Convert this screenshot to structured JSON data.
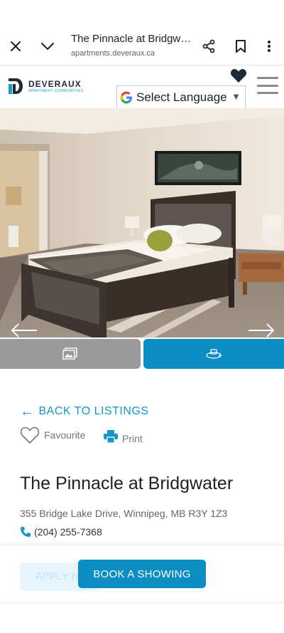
{
  "browser": {
    "title": "The Pinnacle at Bridgwat...",
    "url": "apartments.deveraux.ca"
  },
  "header": {
    "logo_name": "DEVERAUX",
    "logo_sub": "APARTMENT COMMUNITIES",
    "language_select": "Select Language"
  },
  "listing": {
    "back_label": "BACK TO LISTINGS",
    "favourite_label": "Favourite",
    "print_label": "Print",
    "title": "The Pinnacle at Bridgwater",
    "address": "355 Bridge Lake Drive, Winnipeg, MB R3Y 1Z3",
    "phone": "(204) 255-7368"
  },
  "cta": {
    "apply_label": "APPLY N",
    "book_label": "BOOK A SHOWING"
  },
  "colors": {
    "brand_blue": "#0b8fc2",
    "link_blue": "#1596c9",
    "toggle_gray": "#9a9a9a"
  },
  "icons": [
    "close-icon",
    "chevron-down-icon",
    "share-icon",
    "bookmark-icon",
    "more-vert-icon",
    "heart-icon",
    "menu-icon",
    "google-icon",
    "photos-icon",
    "virtual-tour-icon",
    "arrow-left-icon",
    "arrow-right-icon",
    "print-icon",
    "phone-icon"
  ]
}
